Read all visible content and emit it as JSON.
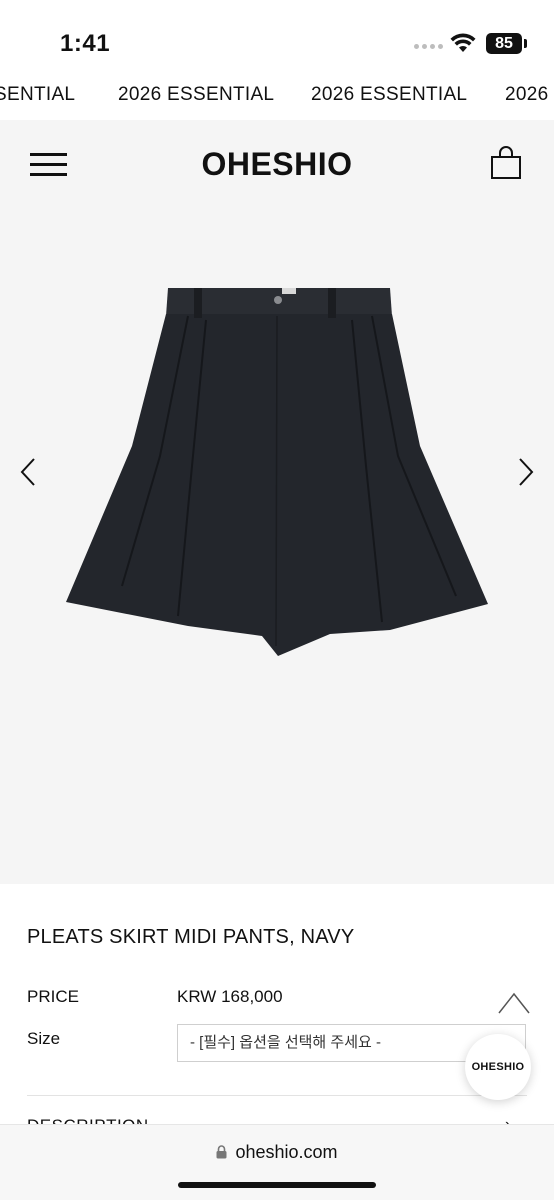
{
  "status_bar": {
    "time": "1:41",
    "battery": "85"
  },
  "marquee": {
    "items": [
      "SENTIAL",
      "2026 ESSENTIAL",
      "2026 ESSENTIAL",
      "2026"
    ]
  },
  "header": {
    "logo": "OHESHIO",
    "menu_icon": "hamburger-icon",
    "cart_icon": "shopping-bag-icon"
  },
  "gallery": {
    "prev_icon": "chevron-left-icon",
    "next_icon": "chevron-right-icon",
    "background": "#f5f5f5",
    "product_color": "#23262c"
  },
  "product": {
    "name": "PLEATS SKIRT MIDI PANTS, NAVY",
    "price_label": "PRICE",
    "price_value": "KRW 168,000",
    "size_label": "Size",
    "size_placeholder": "- [필수] 옵션을 선택해 주세요 -",
    "description_label": "DESCRIPTION",
    "description_arrow": "›"
  },
  "floating": {
    "chat_label": "OHESHIO",
    "scroll_top_icon": "chevron-up-icon"
  },
  "url_bar": {
    "url": "oheshio.com",
    "lock_icon": "lock-icon"
  }
}
